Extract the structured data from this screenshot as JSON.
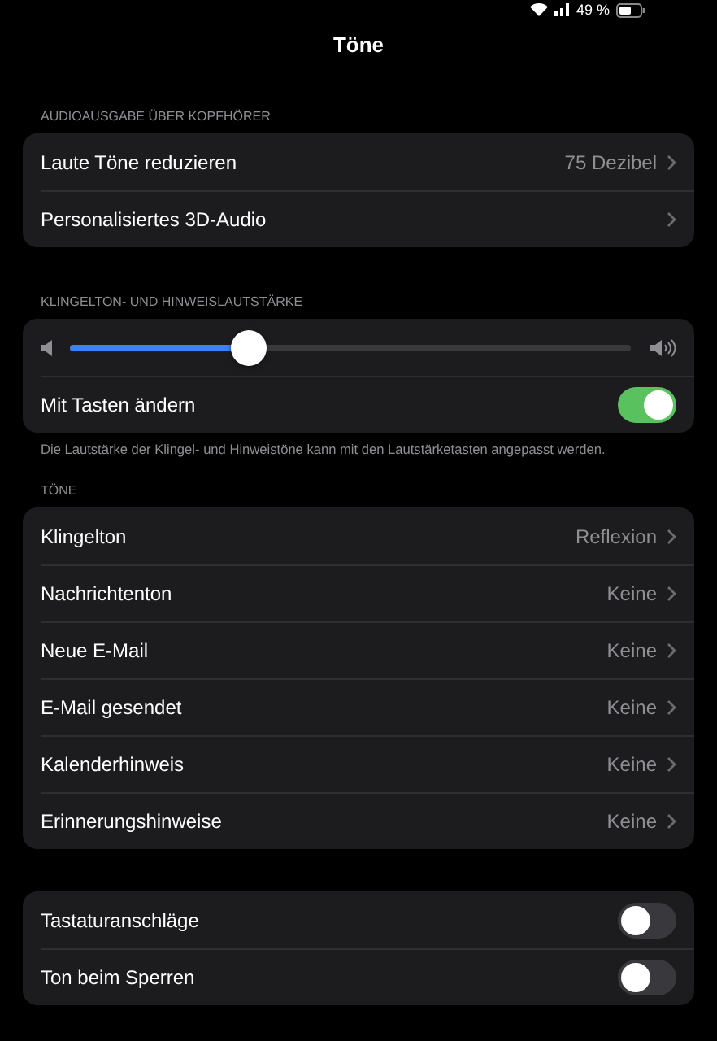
{
  "status_bar": {
    "battery_text": "49 %"
  },
  "title": "Töne",
  "sections": [
    {
      "header": "AUDIOAUSGABE ÜBER KOPFHÖRER",
      "rows": [
        {
          "kind": "link",
          "label": "Laute Töne reduzieren",
          "value": "75 Dezibel"
        },
        {
          "kind": "link",
          "label": "Personalisiertes 3D-Audio"
        }
      ]
    },
    {
      "header": "KLINGELTON- UND HINWEISLAUTSTÄRKE",
      "rows": [
        {
          "kind": "slider",
          "level": 0.32
        },
        {
          "kind": "toggle",
          "label": "Mit Tasten ändern",
          "on": true
        }
      ],
      "footer": "Die Lautstärke der Klingel- und Hinweistöne kann mit den Lautstärketasten angepasst werden."
    },
    {
      "header": "TÖNE",
      "rows": [
        {
          "kind": "link",
          "label": "Klingelton",
          "value": "Reflexion"
        },
        {
          "kind": "link",
          "label": "Nachrichtenton",
          "value": "Keine"
        },
        {
          "kind": "link",
          "label": "Neue E-Mail",
          "value": "Keine"
        },
        {
          "kind": "link",
          "label": "E-Mail gesendet",
          "value": "Keine"
        },
        {
          "kind": "link",
          "label": "Kalenderhinweis",
          "value": "Keine"
        },
        {
          "kind": "link",
          "label": "Erinnerungshinweise",
          "value": "Keine"
        }
      ]
    },
    {
      "rows": [
        {
          "kind": "toggle",
          "label": "Tastaturanschläge",
          "on": false
        },
        {
          "kind": "toggle",
          "label": "Ton beim Sperren",
          "on": false
        }
      ]
    }
  ]
}
